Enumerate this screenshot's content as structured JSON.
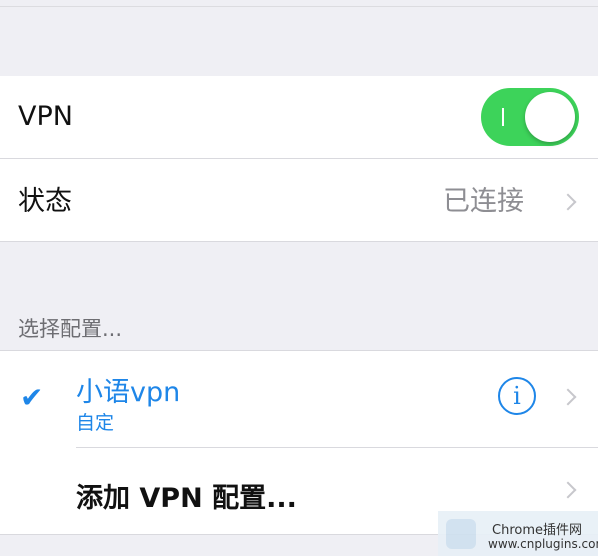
{
  "vpn": {
    "label": "VPN",
    "enabled": true
  },
  "status": {
    "label": "状态",
    "value": "已连接"
  },
  "configs": {
    "header": "选择配置...",
    "items": [
      {
        "name": "小语vpn",
        "subtitle": "自定",
        "selected": true
      }
    ],
    "add_label": "添加 VPN 配置..."
  },
  "watermark": {
    "line1": "Chrome插件网",
    "line2": "www.cnplugins.com"
  },
  "colors": {
    "accent": "#1e86e8",
    "toggle_on": "#3dd35a",
    "background": "#efeff4"
  }
}
